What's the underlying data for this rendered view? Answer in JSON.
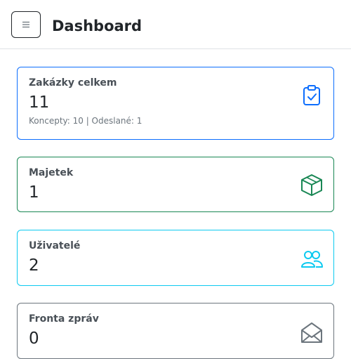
{
  "header": {
    "menu_icon": "hamburger-icon",
    "title": "Dashboard"
  },
  "cards": [
    {
      "label": "Zakázky celkem",
      "value": "11",
      "detail": "Koncepty: 10 | Odeslané: 1",
      "icon": "clipboard-check-icon",
      "color": "#0d6efd"
    },
    {
      "label": "Majetek",
      "value": "1",
      "icon": "box-icon",
      "color": "#198754"
    },
    {
      "label": "Uživatelé",
      "value": "2",
      "icon": "users-icon",
      "color": "#0dcaf0"
    },
    {
      "label": "Fronta zpráv",
      "value": "0",
      "icon": "envelope-open-icon",
      "color": "#6c757d"
    }
  ]
}
